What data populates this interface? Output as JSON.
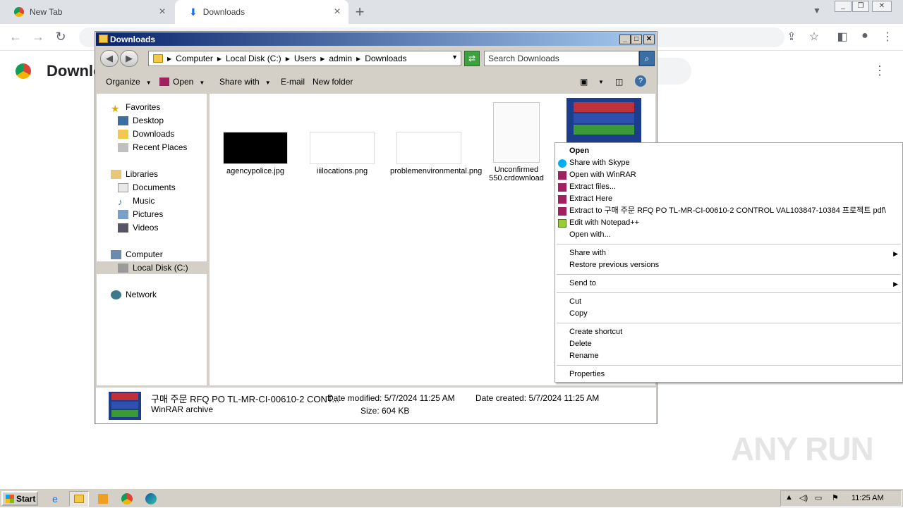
{
  "browser": {
    "tabs": [
      {
        "title": "New Tab"
      },
      {
        "title": "Downloads"
      }
    ],
    "new_tab_symbol": "+",
    "page_title": "Downloads"
  },
  "explorer": {
    "title": "Downloads",
    "breadcrumb": [
      "Computer",
      "Local Disk (C:)",
      "Users",
      "admin",
      "Downloads"
    ],
    "search_placeholder": "Search Downloads",
    "commands": {
      "organize": "Organize",
      "open": "Open",
      "share_with": "Share with",
      "email": "E-mail",
      "new_folder": "New folder"
    },
    "nav": {
      "favorites": "Favorites",
      "desktop": "Desktop",
      "downloads": "Downloads",
      "recent": "Recent Places",
      "libraries": "Libraries",
      "documents": "Documents",
      "music": "Music",
      "pictures": "Pictures",
      "videos": "Videos",
      "computer": "Computer",
      "local_disk": "Local Disk (C:)",
      "network": "Network"
    },
    "files": [
      {
        "name": "agencypolice.jpg"
      },
      {
        "name": "iiilocations.png"
      },
      {
        "name": "problemenvironmental.png"
      },
      {
        "name": "Unconfirmed 550.crdownload"
      }
    ],
    "details": {
      "filename": "구매 주문 RFQ PO TL-MR-CI-00610-2 CONT...",
      "type": "WinRAR archive",
      "date_modified_label": "Date modified:",
      "date_modified": "5/7/2024 11:25 AM",
      "date_created_label": "Date created:",
      "date_created": "5/7/2024 11:25 AM",
      "size_label": "Size:",
      "size": "604 KB"
    }
  },
  "context_menu": {
    "open": "Open",
    "share_skype": "Share with Skype",
    "open_winrar": "Open with WinRAR",
    "extract_files": "Extract files...",
    "extract_here": "Extract Here",
    "extract_to": "Extract to 구매 주문 RFQ PO TL-MR-CI-00610-2 CONTROL VAL103847-10384 프로젝트 pdf\\",
    "edit_notepad": "Edit with Notepad++",
    "open_with": "Open with...",
    "share_with": "Share with",
    "restore": "Restore previous versions",
    "send_to": "Send to",
    "cut": "Cut",
    "copy": "Copy",
    "create_shortcut": "Create shortcut",
    "delete": "Delete",
    "rename": "Rename",
    "properties": "Properties"
  },
  "taskbar": {
    "start": "Start",
    "clock": "11:25 AM"
  },
  "watermark": "ANY RUN"
}
